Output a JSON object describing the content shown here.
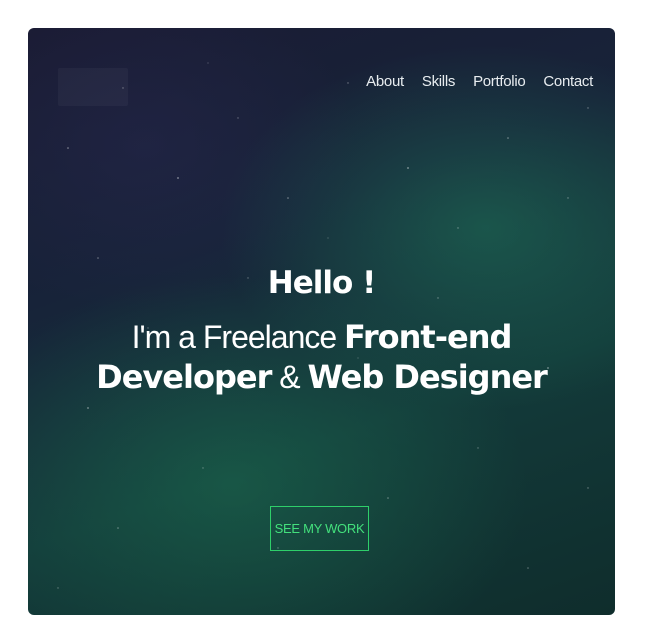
{
  "nav": {
    "items": [
      {
        "label": "About"
      },
      {
        "label": "Skills"
      },
      {
        "label": "Portfolio"
      },
      {
        "label": "Contact"
      }
    ]
  },
  "hero": {
    "greeting": "Hello !",
    "line1_thin": "I'm a Freelance ",
    "line1_bold": "Front-end",
    "line2_bold_a": "Developer",
    "line2_thin": " & ",
    "line2_bold_b": "Web Designer"
  },
  "cta": {
    "label": "SEE MY WORK"
  },
  "colors": {
    "accent": "#2ecf6a",
    "text": "#ffffff",
    "background_dark": "#172339",
    "background_green": "#133a3a"
  }
}
